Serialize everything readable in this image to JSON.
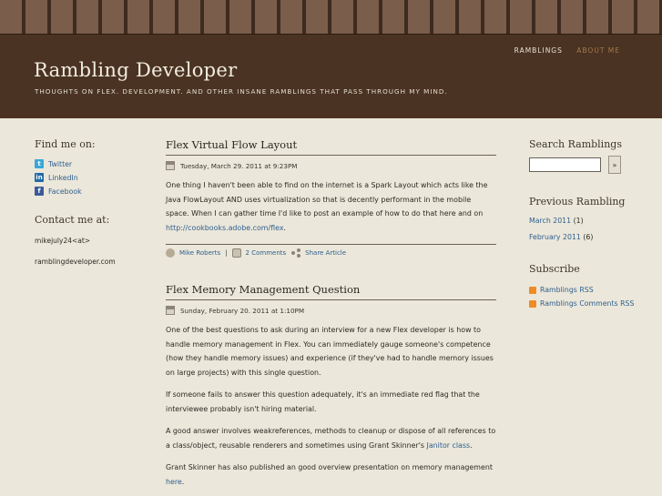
{
  "site": {
    "title": "Rambling Developer",
    "tagline": "THOUGHTS ON FLEX. DEVELOPMENT. AND OTHER INSANE RAMBLINGS THAT PASS THROUGH MY MIND."
  },
  "nav": {
    "ramblings": "RAMBLINGS",
    "about": "ABOUT ME"
  },
  "left_sidebar": {
    "find_heading": "Find me on:",
    "social": [
      {
        "label": "Twitter",
        "icon": "twitter-icon"
      },
      {
        "label": "LinkedIn",
        "icon": "linkedin-icon"
      },
      {
        "label": "Facebook",
        "icon": "facebook-icon"
      }
    ],
    "contact_heading": "Contact me at:",
    "contact_lines": [
      "mikejuly24<at>",
      "ramblingdeveloper.com"
    ]
  },
  "posts": [
    {
      "title": "Flex Virtual Flow Layout",
      "date": "Tuesday, March 29. 2011 at 9:23PM",
      "body_text": "One thing I haven't been able to find on the internet is a Spark Layout which acts like the Java FlowLayout AND uses virtualization so that is decently performant in the mobile space.  When I can gather time I'd like to post an example of how to do that here and on ",
      "link": "http://cookbooks.adobe.com/flex",
      "link_after": ".",
      "author": "Mike Roberts",
      "separator": "|",
      "comments": "2 Comments",
      "share": "Share Article"
    },
    {
      "title": "Flex Memory Management Question",
      "date": "Sunday, February 20. 2011 at 1:10PM",
      "p1": "One of the best questions to ask during an interview for a new Flex developer is how to handle memory management in Flex.  You can immediately gauge someone's competence (how they handle memory issues) and experience (if they've had to handle memory issues on large projects) with this single question.",
      "p2": "If someone fails to answer this question adequately, it's an immediate red flag that the interviewee probably isn't hiring material.",
      "p3_before": "A good answer involves weakreferences, methods to cleanup or dispose of all references to a class/object, reusable renderers and sometimes using Grant Skinner's ",
      "p3_link": "Janitor class",
      "p3_after": ".",
      "p4_before": "Grant Skinner has also published an good overview presentation on memory management ",
      "p4_link": "here",
      "p4_after": "."
    }
  ],
  "right_sidebar": {
    "search_heading": "Search Ramblings",
    "search_value": "",
    "search_button": "»",
    "previous_heading": "Previous Rambling",
    "archives": [
      {
        "label": "March 2011",
        "count": " (1)"
      },
      {
        "label": "February 2011",
        "count": " (6)"
      }
    ],
    "subscribe_heading": "Subscribe",
    "rss": [
      {
        "label": "Ramblings RSS",
        "icon": "rss-icon"
      },
      {
        "label": "Ramblings Comments RSS",
        "icon": "rss-icon"
      }
    ]
  },
  "colors": {
    "header_bg": "#4a3322",
    "page_bg": "#ebe7da",
    "link": "#2f5f8f",
    "nav_active": "#a7774e",
    "rss": "#f08a24"
  }
}
